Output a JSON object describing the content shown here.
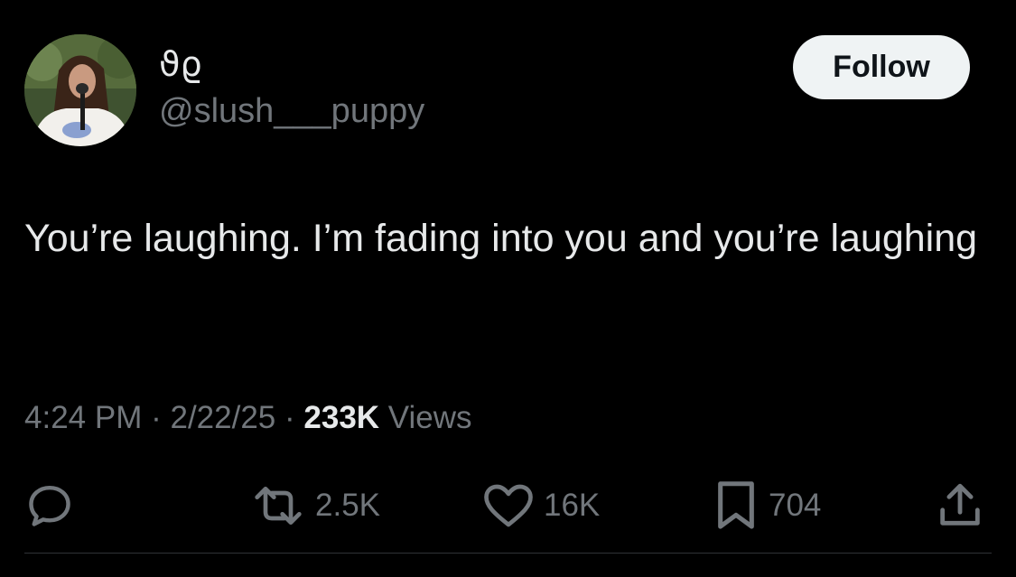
{
  "author": {
    "display_name": "ϑϱ",
    "handle": "@slush___puppy"
  },
  "follow_button": {
    "label": "Follow"
  },
  "tweet": {
    "text": "You’re laughing. I’m fading into you and you’re laughing"
  },
  "meta": {
    "time": "4:24 PM",
    "separator": "·",
    "date": "2/22/25",
    "views_count": "233K",
    "views_label": "Views"
  },
  "actions": {
    "reply_icon": "reply-icon",
    "retweet_icon": "retweet-icon",
    "retweet_count": "2.5K",
    "like_icon": "heart-icon",
    "like_count": "16K",
    "bookmark_icon": "bookmark-icon",
    "bookmark_count": "704",
    "share_icon": "share-icon"
  },
  "colors": {
    "background": "#000000",
    "primary_text": "#e7e9ea",
    "secondary_text": "#71767b",
    "follow_button_bg": "#eff3f4",
    "follow_button_text": "#0f1419",
    "divider": "#2f3336"
  }
}
